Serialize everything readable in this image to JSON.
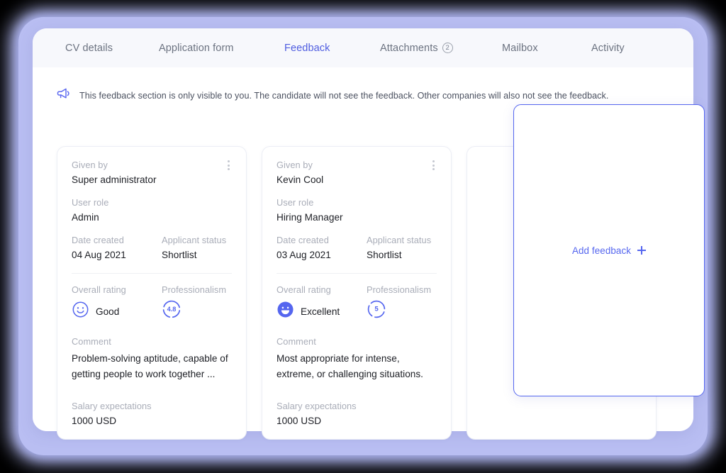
{
  "theme": {
    "accent": "#5566ef",
    "accent_tab": "#4f5de0",
    "label_gray": "#a9adb8",
    "value_dark": "#1c1e24",
    "tabbar_bg": "#f7f8fc",
    "frame_glow": "#b9bef2"
  },
  "tabs": [
    {
      "label": "CV details",
      "active": false,
      "badge": null
    },
    {
      "label": "Application form",
      "active": false,
      "badge": null
    },
    {
      "label": "Feedback",
      "active": true,
      "badge": null
    },
    {
      "label": "Attachments",
      "active": false,
      "badge": "2"
    },
    {
      "label": "Mailbox",
      "active": false,
      "badge": null
    },
    {
      "label": "Activity",
      "active": false,
      "badge": null
    }
  ],
  "notice": {
    "icon": "megaphone-icon",
    "text": "This feedback section is only visible to you. The candidate will not see the feedback. Other companies will also not see the feedback."
  },
  "labels": {
    "given_by": "Given by",
    "user_role": "User role",
    "date_created": "Date created",
    "applicant_status": "Applicant status",
    "overall_rating": "Overall rating",
    "professionalism": "Professionalism",
    "comment": "Comment",
    "salary_expectations": "Salary expectations"
  },
  "cards": [
    {
      "given_by": "Super administrator",
      "user_role": "Admin",
      "date_created": "04 Aug 2021",
      "applicant_status": "Shortlist",
      "overall_rating_text": "Good",
      "overall_rating_face": "smile-outline-icon",
      "professionalism_score": "4.8",
      "professionalism_pct": 80,
      "comment": "Problem-solving aptitude, capable of getting people to work together ...",
      "salary": "1000 USD"
    },
    {
      "given_by": "Kevin Cool",
      "user_role": "Hiring Manager",
      "date_created": "03 Aug 2021",
      "applicant_status": "Shortlist",
      "overall_rating_text": "Excellent",
      "overall_rating_face": "grin-filled-icon",
      "professionalism_score": "5",
      "professionalism_pct": 88,
      "comment": "Most appropriate for intense, extreme, or challenging situations.",
      "salary": "1000 USD"
    }
  ],
  "add_feedback": {
    "label": "Add feedback",
    "icon": "plus-icon"
  }
}
